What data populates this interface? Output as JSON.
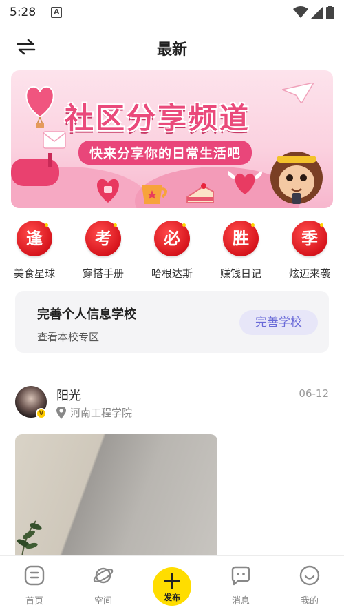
{
  "status_bar": {
    "time": "5:28"
  },
  "header": {
    "title": "最新"
  },
  "banner": {
    "title": "社区分享频道",
    "subtitle": "快来分享你的日常生活吧"
  },
  "categories": [
    {
      "badge": "逢",
      "label": "美食星球"
    },
    {
      "badge": "考",
      "label": "穿搭手册"
    },
    {
      "badge": "必",
      "label": "哈根达斯"
    },
    {
      "badge": "胜",
      "label": "赚钱日记"
    },
    {
      "badge": "季",
      "label": "炫迈来袭"
    }
  ],
  "school_card": {
    "title": "完善个人信息学校",
    "subtitle": "查看本校专区",
    "button": "完善学校"
  },
  "post": {
    "username": "阳光",
    "badge": "V",
    "location": "河南工程学院",
    "date": "06-12"
  },
  "tabbar": {
    "home": "首页",
    "space": "空间",
    "publish": "发布",
    "messages": "消息",
    "mine": "我的"
  },
  "colors": {
    "accent_yellow": "#ffdd00",
    "category_red": "#d7151d",
    "banner_pink": "#ea4a7b",
    "school_button_text": "#6a6ad8"
  },
  "icons": [
    "switch-icon",
    "location-icon",
    "home-icon",
    "planet-icon",
    "plus-icon",
    "message-icon",
    "smile-icon",
    "wifi-icon",
    "signal-icon",
    "battery-icon"
  ]
}
